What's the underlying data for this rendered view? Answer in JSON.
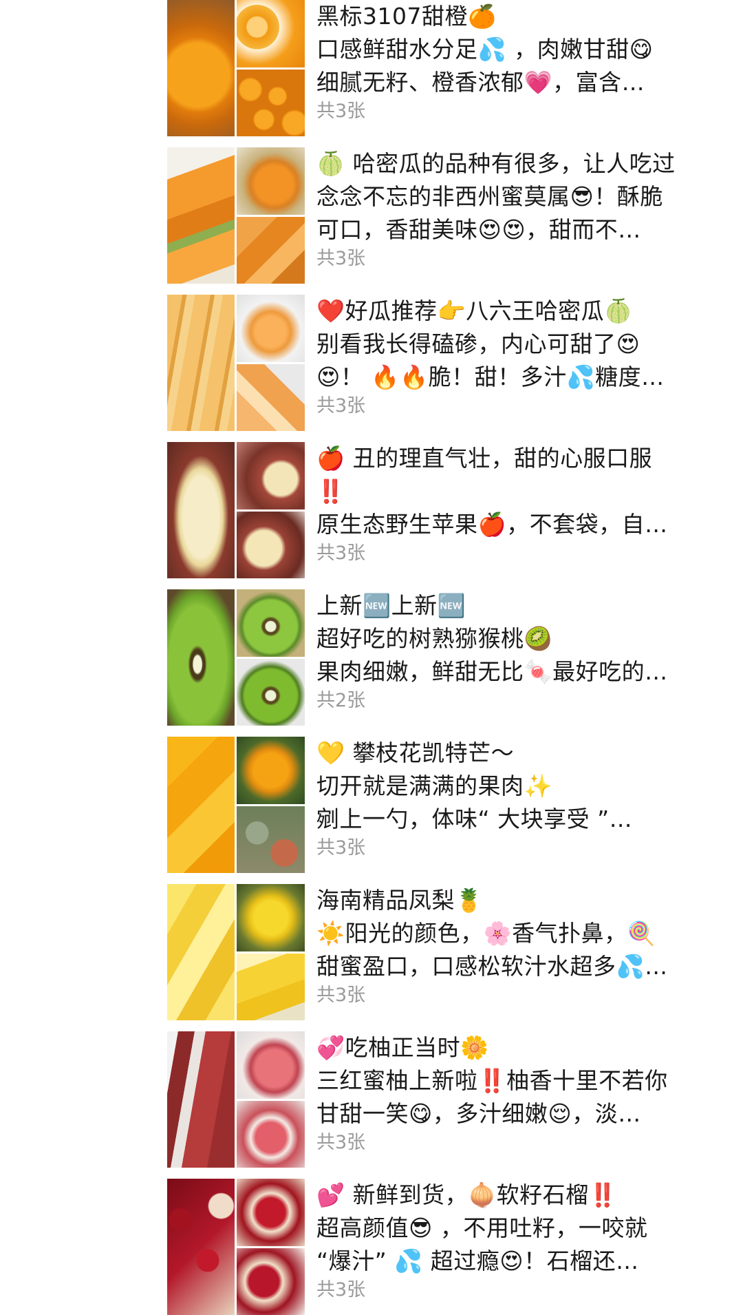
{
  "posts": [
    {
      "lines": [
        "黑标3107甜橙🍊",
        "口感鲜甜水分足💦 ，肉嫩甘甜😋",
        "细腻无籽、橙香浓郁💗，富含…"
      ],
      "photo_count": "共3张"
    },
    {
      "lines": [
        "🍈 哈密瓜的品种有很多，让人吃过",
        "念念不忘的非西州蜜莫属😎！酥脆",
        "可口，香甜美味😍😍，甜而不…"
      ],
      "photo_count": "共3张"
    },
    {
      "lines": [
        "❤️好瓜推荐👉八六王哈密瓜🍈",
        "别看我长得磕碜，内心可甜了😍",
        "😍！ 🔥🔥脆！甜！多汁💦糖度…"
      ],
      "photo_count": "共3张"
    },
    {
      "lines": [
        "🍎 丑的理直气壮，甜的心服口服",
        "‼️",
        "原生态野生苹果🍎，不套袋，自…"
      ],
      "photo_count": "共3张"
    },
    {
      "lines": [
        "上新🆕上新🆕",
        "超好吃的树熟猕猴桃🥝",
        "果肉细嫩，鲜甜无比🍬最好吃的…"
      ],
      "photo_count": "共2张"
    },
    {
      "lines": [
        "💛 攀枝花凯特芒～",
        "切开就是满满的果肉✨",
        " 剜上一勺，体味“ 大块享受 ”…"
      ],
      "photo_count": "共3张"
    },
    {
      "lines": [
        "海南精品凤梨🍍",
        "☀️阳光的颜色，🌸香气扑鼻，🍭",
        "甜蜜盈口，口感松软汁水超多💦…"
      ],
      "photo_count": "共3张"
    },
    {
      "lines": [
        "💞吃柚正当时🌼",
        "三红蜜柚上新啦‼️柚香十里不若你",
        "甘甜一笑😋，多汁细嫩😌，淡…"
      ],
      "photo_count": "共3张"
    },
    {
      "lines": [
        "💕 新鲜到货，🧅软籽石榴‼️",
        " 超高颜值😎 ，不用吐籽，一咬就",
        "“爆汁” 💦 超过瘾😍！石榴还…"
      ],
      "photo_count": "共3张"
    }
  ]
}
